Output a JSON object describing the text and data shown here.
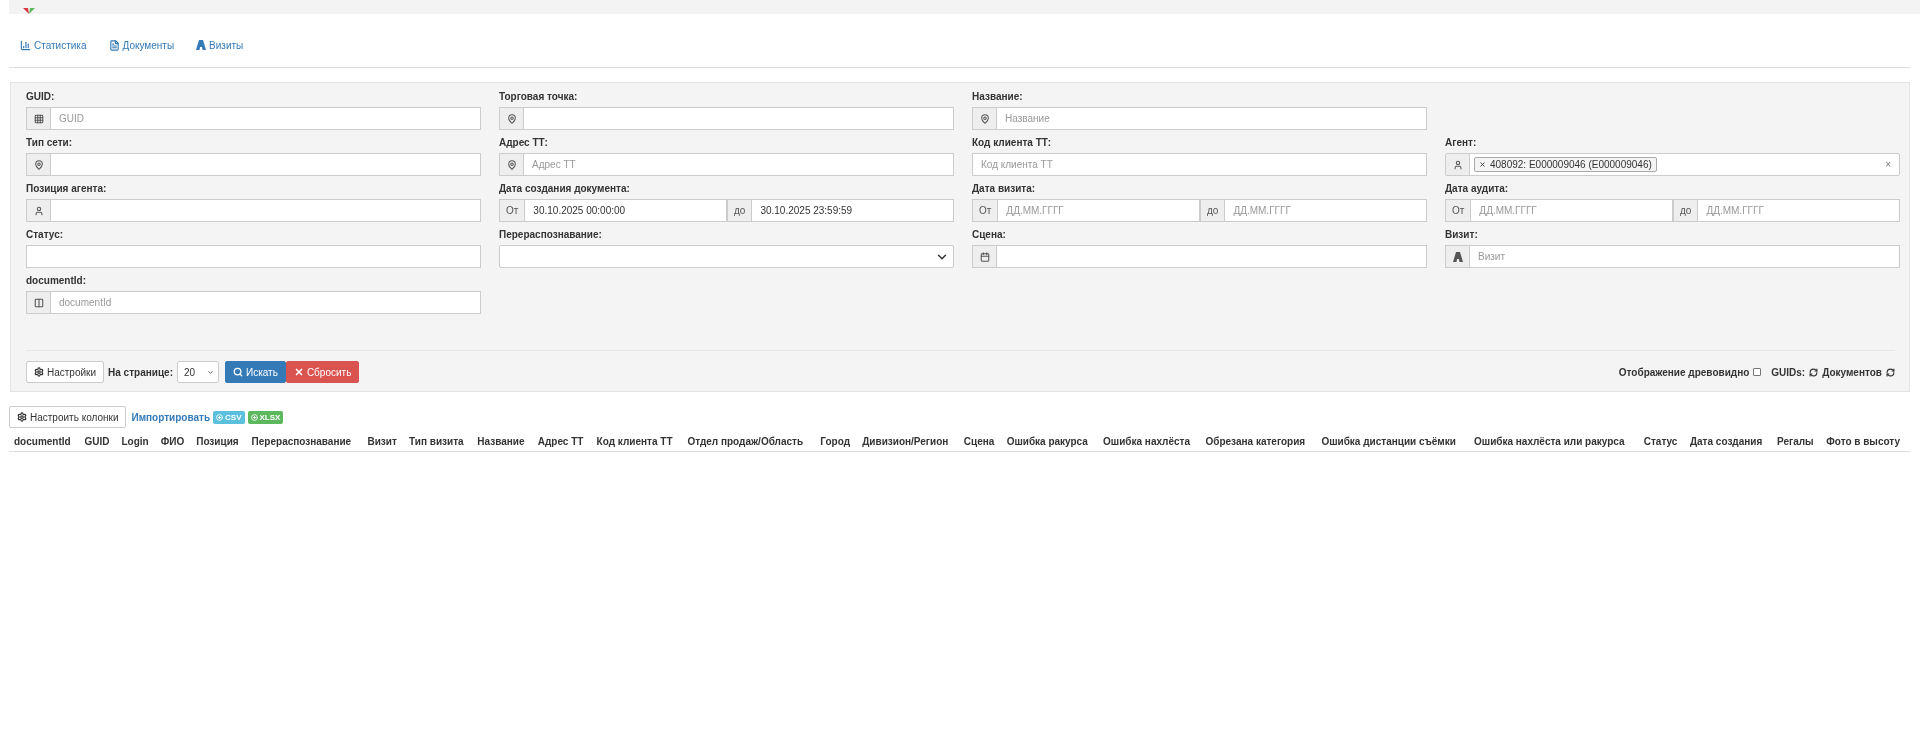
{
  "nav_tabs": [
    {
      "kind": "chart",
      "label": "Статистика"
    },
    {
      "kind": "file",
      "label": "Документы"
    },
    {
      "kind": "road",
      "label": "Визиты"
    }
  ],
  "filters": [
    [
      {
        "kind": "grid",
        "label": "GUID:",
        "placeholder": "GUID"
      },
      {
        "kind": "pin",
        "label": "Торговая точка:"
      },
      {
        "kind": "pin",
        "label": "Название:",
        "placeholder": "Название"
      }
    ],
    [
      {
        "kind": "pin",
        "label": "Тип сети:"
      },
      {
        "kind": "pin",
        "label": "Адрес ТТ:",
        "placeholder": "Адрес ТТ"
      },
      {
        "kind": "plain",
        "label": "Код клиента ТТ:",
        "placeholder": "Код клиента ТТ"
      },
      {
        "kind": "tags",
        "label": "Агент:",
        "tags": [
          "408092: E000009046 (E000009046)"
        ],
        "clear": "×"
      }
    ],
    [
      {
        "kind": "person",
        "label": "Позиция агента:"
      },
      {
        "kind": "range",
        "label": "Дата создания документа:",
        "from": "От",
        "to": "до",
        "from_value": "30.10.2025 00:00:00",
        "to_value": "30.10.2025 23:59:59"
      },
      {
        "kind": "range",
        "label": "Дата визита:",
        "from": "От",
        "to": "до",
        "from_placeholder": "ДД.ММ.ГГГГ",
        "to_placeholder": "ДД.ММ.ГГГГ"
      },
      {
        "kind": "range",
        "label": "Дата аудита:",
        "from": "От",
        "to": "до",
        "from_placeholder": "ДД.ММ.ГГГГ",
        "to_placeholder": "ДД.ММ.ГГГГ"
      }
    ],
    [
      {
        "kind": "plain",
        "label": "Статус:"
      },
      {
        "kind": "select",
        "label": "Перераспознавание:"
      },
      {
        "kind": "scene",
        "label": "Сцена:"
      },
      {
        "kind": "road",
        "label": "Визит:",
        "placeholder": "Визит"
      }
    ],
    [
      {
        "kind": "columns",
        "label": "documentId:",
        "placeholder": "documentId"
      }
    ]
  ],
  "controls": {
    "settings": "Настройки",
    "per_page_label": "На странице:",
    "per_page": "20",
    "search": "Искать",
    "reset": "Сбросить",
    "tree_label": "Отображение древовидно",
    "tree_checked": false,
    "guids": "GUIDs:",
    "documents": "Документов"
  },
  "table_toolbar": {
    "columns_button": "Настроить колонки",
    "import": "Импортировать",
    "formats": [
      {
        "label": "CSV",
        "color": "#5bc0de"
      },
      {
        "label": "XLSX",
        "color": "#5cb85c"
      }
    ]
  },
  "table": {
    "columns": [
      "documentId",
      "GUID",
      "Login",
      "ФИО",
      "Позиция",
      "Перераспознавание",
      "Визит",
      "Тип визита",
      "Название",
      "Адрес ТТ",
      "Код клиента ТТ",
      "Отдел продаж/Область",
      "Город",
      "Дивизион/Регион",
      "Сцена",
      "Ошибка ракурса",
      "Ошибка нахлёста",
      "Обрезана категория",
      "Ошибка дистанции съёмки",
      "Ошибка нахлёста или ракурса",
      "Статус",
      "Дата создания",
      "Регалы",
      "Фото в высоту"
    ]
  }
}
